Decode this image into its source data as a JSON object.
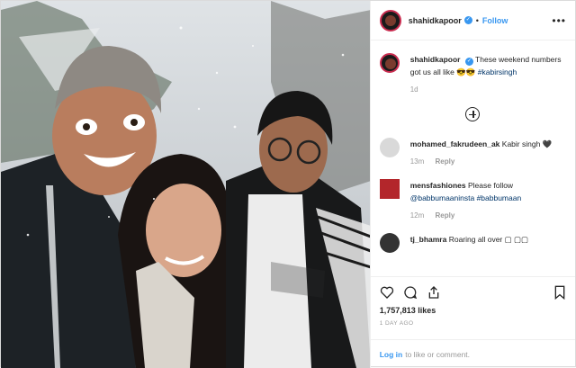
{
  "post": {
    "username": "shahidkapoor",
    "follow_label": "Follow",
    "dot": "•",
    "more_label": "•••",
    "caption": {
      "username": "shahidkapoor",
      "text": "These weekend numbers got us all like 😎😎",
      "hashtag": "#kabirsingh",
      "time": "1d"
    },
    "comments": [
      {
        "username": "mohamed_fakrudeen_ak",
        "text": "Kabir singh 🖤",
        "time": "13m",
        "reply": "Reply",
        "avatar_color": "#d9d9d9"
      },
      {
        "username": "mensfashiones",
        "text": "Please follow",
        "mentions": "@babbumaaninsta #babbumaan",
        "time": "12m",
        "reply": "Reply",
        "avatar_color": "#b3262b"
      },
      {
        "username": "tj_bhamra",
        "text": "Roaring all over ▢ ▢▢",
        "time": "",
        "reply": "",
        "avatar_color": "#333333"
      }
    ],
    "likes": "1,757,813 likes",
    "posted": "1 DAY AGO",
    "login_link": "Log in",
    "login_text": "to like or comment."
  },
  "colors": {
    "accent": "#3897f0",
    "brand_ring": "#c92c4f"
  },
  "icons": [
    "heart-icon",
    "comment-icon",
    "share-icon",
    "bookmark-icon",
    "plus-circle-icon",
    "verified-badge-icon",
    "more-options-icon"
  ]
}
